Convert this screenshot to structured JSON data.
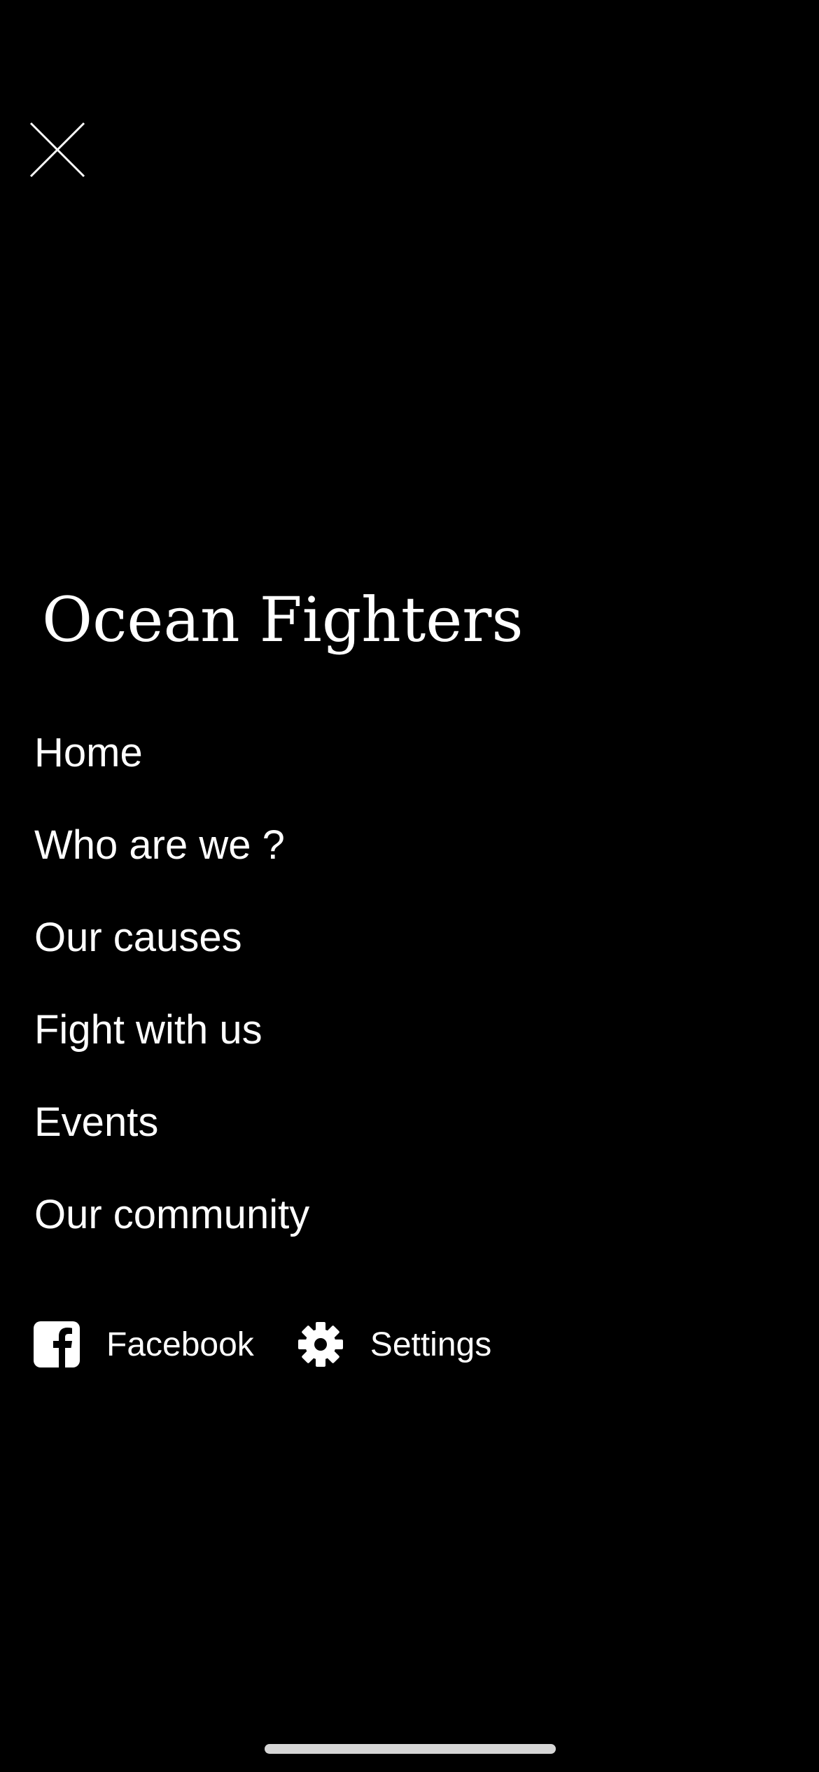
{
  "colors": {
    "background": "#000000",
    "text": "#ffffff",
    "home_indicator": "#d6d6d6"
  },
  "header": {
    "close_icon": "close-icon"
  },
  "brand": {
    "title": "Ocean Fighters"
  },
  "nav": {
    "items": [
      {
        "label": "Home"
      },
      {
        "label": "Who are we ?"
      },
      {
        "label": "Our causes"
      },
      {
        "label": "Fight with us"
      },
      {
        "label": "Events"
      },
      {
        "label": "Our community"
      }
    ]
  },
  "footer": {
    "facebook": {
      "label": "Facebook",
      "icon": "facebook-icon"
    },
    "settings": {
      "label": "Settings",
      "icon": "gear-icon"
    }
  }
}
